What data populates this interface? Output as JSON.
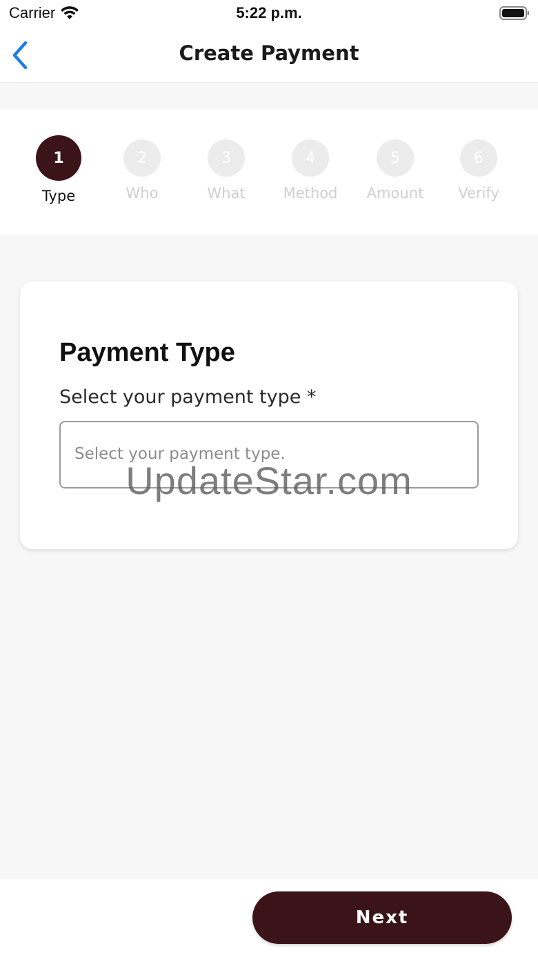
{
  "status_bar": {
    "carrier": "Carrier",
    "time": "5:22 p.m.",
    "wifi_icon": "wifi-icon",
    "battery_icon": "battery-full-icon"
  },
  "nav": {
    "title": "Create Payment",
    "back_icon": "chevron-left-icon"
  },
  "stepper": {
    "active_color": "#3b1419",
    "steps": [
      {
        "number": "1",
        "label": "Type",
        "state": "active"
      },
      {
        "number": "2",
        "label": "Who",
        "state": "inactive"
      },
      {
        "number": "3",
        "label": "What",
        "state": "inactive"
      },
      {
        "number": "4",
        "label": "Method",
        "state": "inactive"
      },
      {
        "number": "5",
        "label": "Amount",
        "state": "inactive"
      },
      {
        "number": "6",
        "label": "Verify",
        "state": "inactive"
      }
    ]
  },
  "card": {
    "title": "Payment Type",
    "field_label": "Select your payment type *",
    "placeholder": "Select your payment type."
  },
  "watermark": "UpdateStar.com",
  "footer": {
    "next_label": "Next",
    "button_color": "#3b1419"
  }
}
